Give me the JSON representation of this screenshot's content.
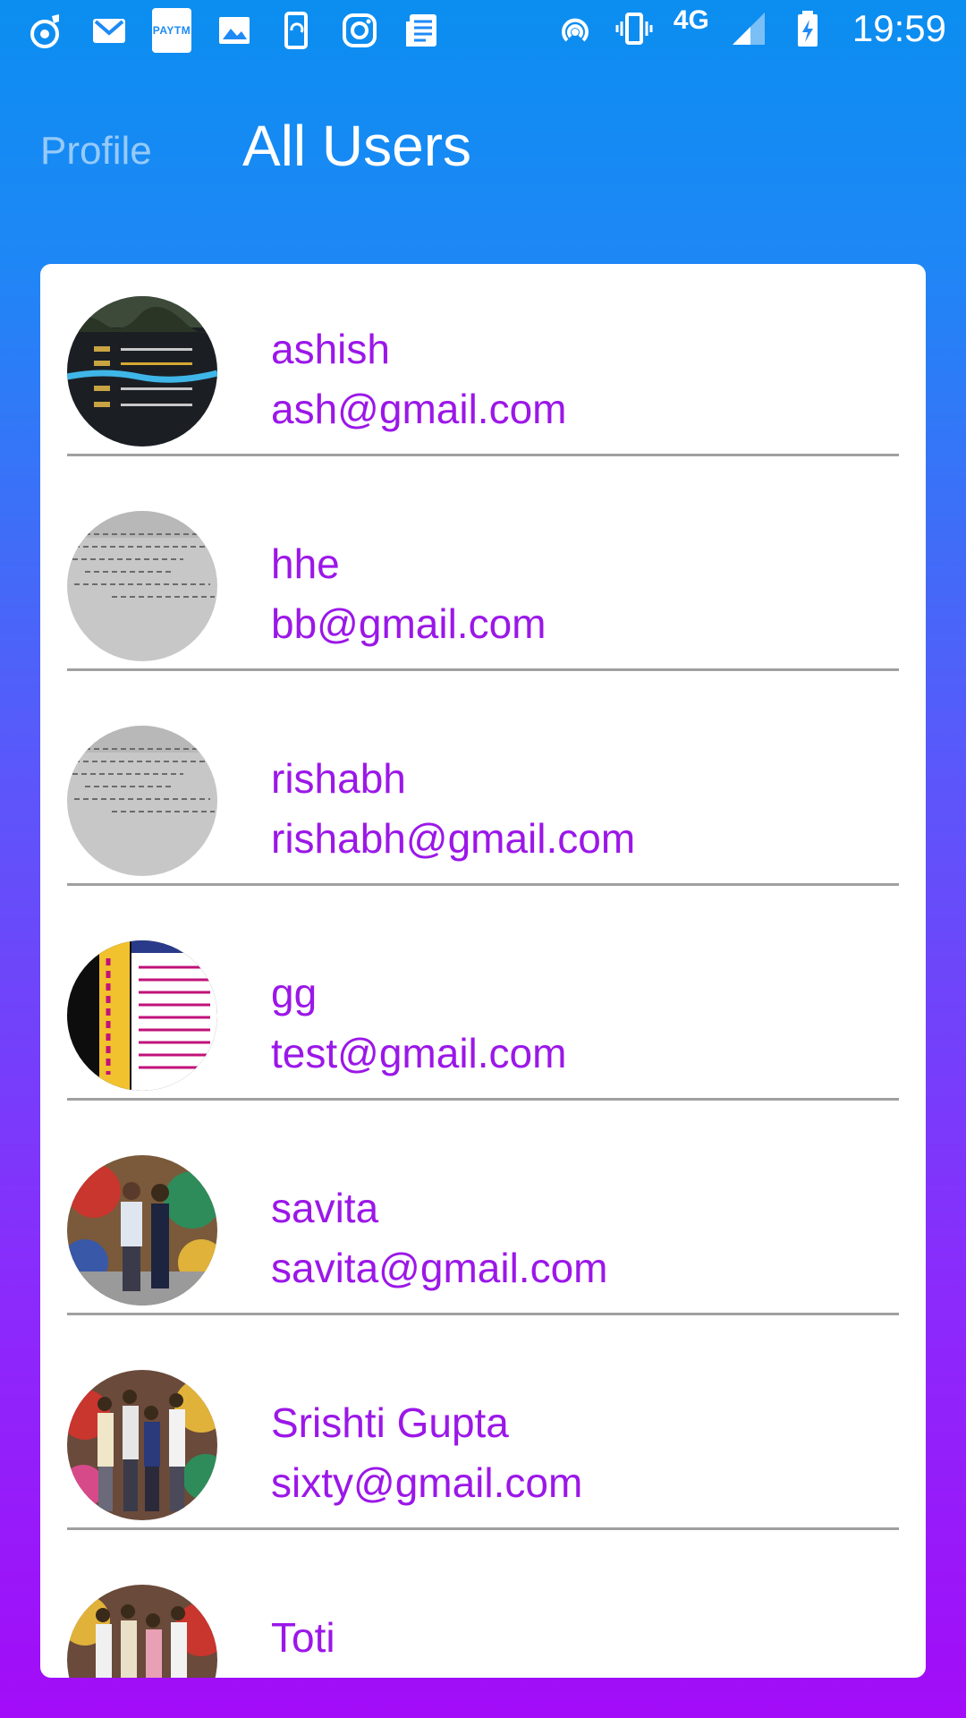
{
  "status_bar": {
    "paytm_label": "PAYTM",
    "network_type": "4G",
    "time": "19:59",
    "icons": [
      "music-icon",
      "gmail-icon",
      "paytm-icon",
      "gallery-icon",
      "phone-sync-icon",
      "instagram-icon",
      "news-icon",
      "hotspot-icon",
      "vibrate-icon",
      "signal-icon",
      "battery-charging-icon"
    ]
  },
  "tabs": [
    {
      "label": "Profile",
      "active": false
    },
    {
      "label": "All Users",
      "active": true
    }
  ],
  "users": [
    {
      "name": "ashish",
      "email": "ash@gmail.com",
      "avatar": "avatar-leaderboard-image"
    },
    {
      "name": "hhe",
      "email": "bb@gmail.com",
      "avatar": "avatar-handwritten-note-image"
    },
    {
      "name": "rishabh",
      "email": "rishabh@gmail.com",
      "avatar": "avatar-handwritten-note-image"
    },
    {
      "name": "gg",
      "email": "test@gmail.com",
      "avatar": "avatar-poster-image"
    },
    {
      "name": "savita",
      "email": "savita@gmail.com",
      "avatar": "avatar-couple-photo"
    },
    {
      "name": "Srishti Gupta",
      "email": "sixty@gmail.com",
      "avatar": "avatar-group-photo"
    },
    {
      "name": "Toti",
      "email": "",
      "avatar": "avatar-group-photo"
    }
  ],
  "colors": {
    "text_accent": "#9b17e8",
    "gradient_top": "#0b8ef0",
    "gradient_bottom": "#a20cf8",
    "divider": "#a0a0a0"
  }
}
